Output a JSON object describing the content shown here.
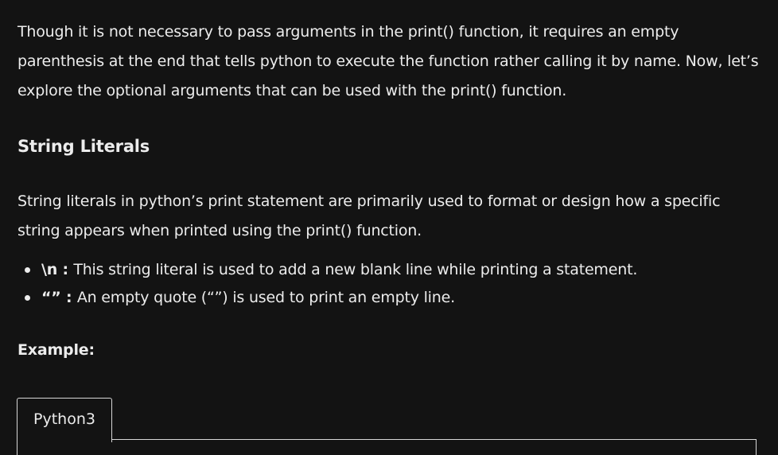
{
  "intro": {
    "before_code_1": "Though it is not necessary to pass arguments in the ",
    "code_1": "print()",
    "between": " function, it requires an empty parenthesis at the end that tells python to execute the function rather calling it by name. Now, let’s explore the optional arguments that can be used with the ",
    "code_2": "print()",
    "after": " function."
  },
  "section": {
    "heading": "String Literals"
  },
  "literals": {
    "before_code": "String literals in python’s print statement are primarily used to format or design how a specific string appears when printed using the ",
    "code": "print()",
    "after": " function."
  },
  "bullets": [
    {
      "term": "\\n",
      "sep": " : ",
      "text": "This string literal is used to add a new blank line while printing a statement."
    },
    {
      "term": "“”",
      "sep": " : ",
      "text": "An empty quote (“”) is used to print an empty line."
    }
  ],
  "example": {
    "label": "Example:"
  },
  "code_block": {
    "tab_label": "Python3"
  },
  "colors": {
    "background": "#131313",
    "text": "#ececec",
    "border": "#d8d8d8"
  }
}
